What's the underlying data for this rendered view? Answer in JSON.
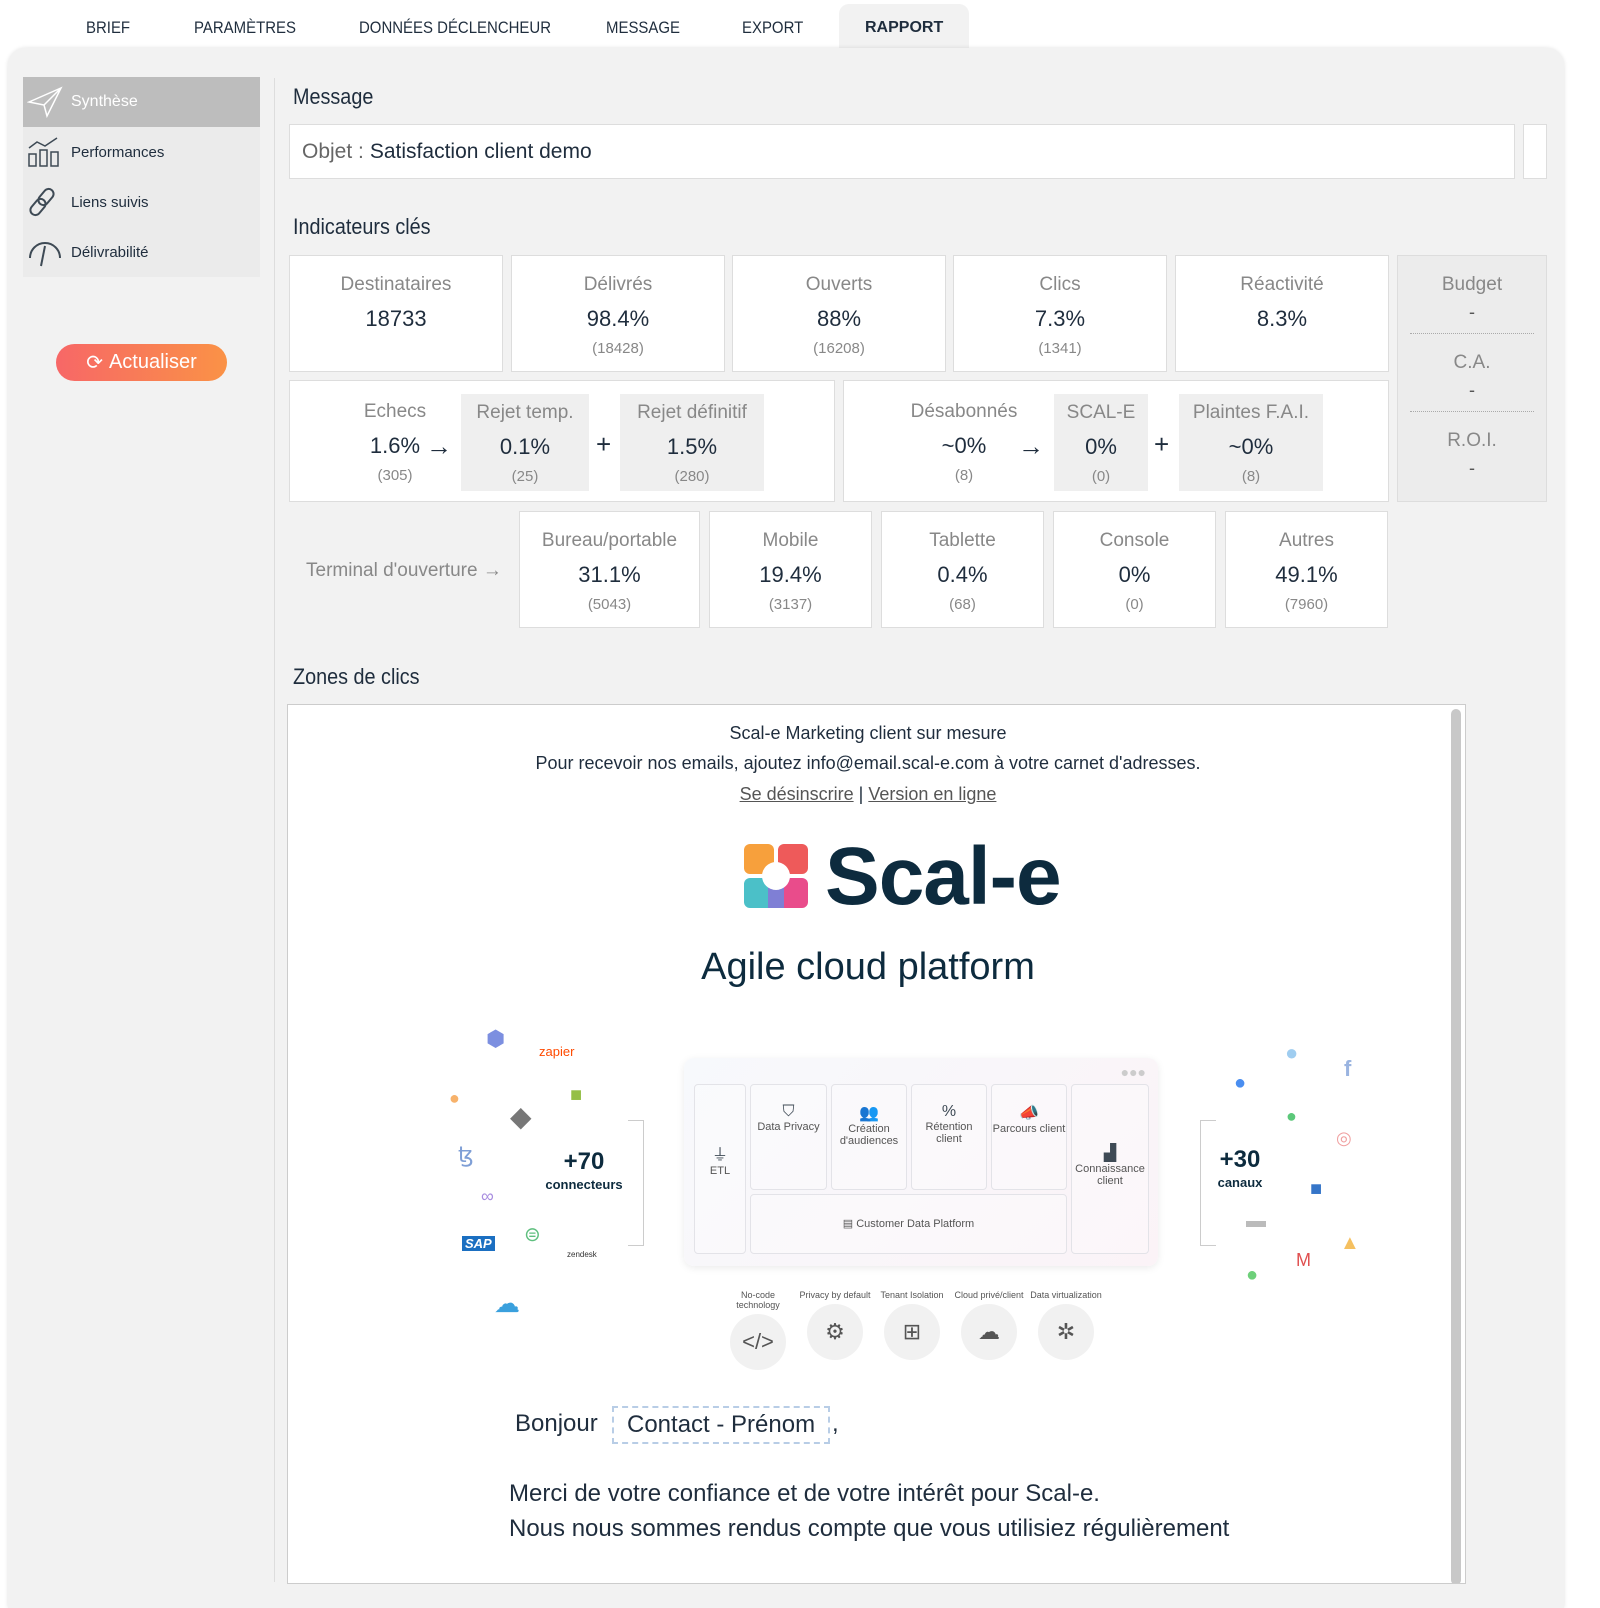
{
  "tabs": [
    {
      "label": "Brief"
    },
    {
      "label": "Paramètres"
    },
    {
      "label": "Données déclencheur"
    },
    {
      "label": "Message"
    },
    {
      "label": "Export"
    },
    {
      "label": "Rapport",
      "active": true
    }
  ],
  "sidebar": {
    "items": [
      {
        "label": "Synthèse",
        "icon": "paper-plane-icon",
        "active": true
      },
      {
        "label": "Performances",
        "icon": "bar-chart-icon"
      },
      {
        "label": "Liens suivis",
        "icon": "link-icon"
      },
      {
        "label": "Délivrabilité",
        "icon": "gauge-icon"
      }
    ],
    "refresh_label": "Actualiser"
  },
  "message": {
    "title": "Message",
    "subject_label": "Objet :",
    "subject": "Satisfaction client demo"
  },
  "kpi": {
    "title": "Indicateurs clés",
    "top": [
      {
        "label": "Destinataires",
        "value": "18733",
        "count": ""
      },
      {
        "label": "Délivrés",
        "value": "98.4%",
        "count": "(18428)"
      },
      {
        "label": "Ouverts",
        "value": "88%",
        "count": "(16208)"
      },
      {
        "label": "Clics",
        "value": "7.3%",
        "count": "(1341)"
      },
      {
        "label": "Réactivité",
        "value": "8.3%",
        "count": ""
      }
    ],
    "failures": {
      "label": "Echecs",
      "value": "1.6%",
      "count": "(305)",
      "soft": {
        "label": "Rejet temp.",
        "value": "0.1%",
        "count": "(25)"
      },
      "hard": {
        "label": "Rejet définitif",
        "value": "1.5%",
        "count": "(280)"
      }
    },
    "unsub": {
      "label": "Désabonnés",
      "value": "~0%",
      "count": "(8)",
      "scale": {
        "label": "SCAL-E",
        "value": "0%",
        "count": "(0)"
      },
      "isp": {
        "label": "Plaintes F.A.I.",
        "value": "~0%",
        "count": "(8)"
      }
    },
    "budget": [
      {
        "label": "Budget",
        "value": "-"
      },
      {
        "label": "C.A.",
        "value": "-"
      },
      {
        "label": "R.O.I.",
        "value": "-"
      }
    ],
    "terminal_label": "Terminal d'ouverture →",
    "devices": [
      {
        "label": "Bureau/portable",
        "value": "31.1%",
        "count": "(5043)"
      },
      {
        "label": "Mobile",
        "value": "19.4%",
        "count": "(3137)"
      },
      {
        "label": "Tablette",
        "value": "0.4%",
        "count": "(68)"
      },
      {
        "label": "Console",
        "value": "0%",
        "count": "(0)"
      },
      {
        "label": "Autres",
        "value": "49.1%",
        "count": "(7960)"
      }
    ],
    "arrow": "→",
    "plus": "+"
  },
  "clicks": {
    "title": "Zones de clics",
    "email": {
      "header1": "Scal-e Marketing client sur mesure",
      "header2": "Pour recevoir nos emails, ajoutez info@email.scal-e.com à votre carnet d'adresses.",
      "unsubscribe": "Se désinscrire",
      "sep": "|",
      "online": "Version en ligne",
      "brand": "Scal-e",
      "tagline": "Agile cloud platform",
      "diagram": {
        "connectors_count": "+70",
        "connectors_label": "connecteurs",
        "channels_count": "+30",
        "channels_label": "canaux",
        "etl": "ETL",
        "modules": [
          "Data Privacy",
          "Création d'audiences",
          "Rétention client",
          "Parcours client"
        ],
        "insight": "Connaissance client",
        "cdp": "Customer Data Platform",
        "badges": [
          "No-code technology",
          "Privacy by default",
          "Tenant Isolation",
          "Cloud privé/client",
          "Data virtualization"
        ],
        "zapier": "zapier",
        "sap": "SAP",
        "zendesk": "zendesk"
      },
      "greeting": "Bonjour",
      "contact_field": "Contact - Prénom",
      "comma": ",",
      "line1": "Merci de votre confiance et de votre intérêt pour Scal-e.",
      "line2": "Nous nous sommes rendus compte que vous utilisiez régulièrement"
    }
  },
  "colors": {
    "accent_start": "#f76767",
    "accent_end": "#fa9246",
    "text": "#1f2d3d",
    "brand": "#0d2b3e"
  }
}
